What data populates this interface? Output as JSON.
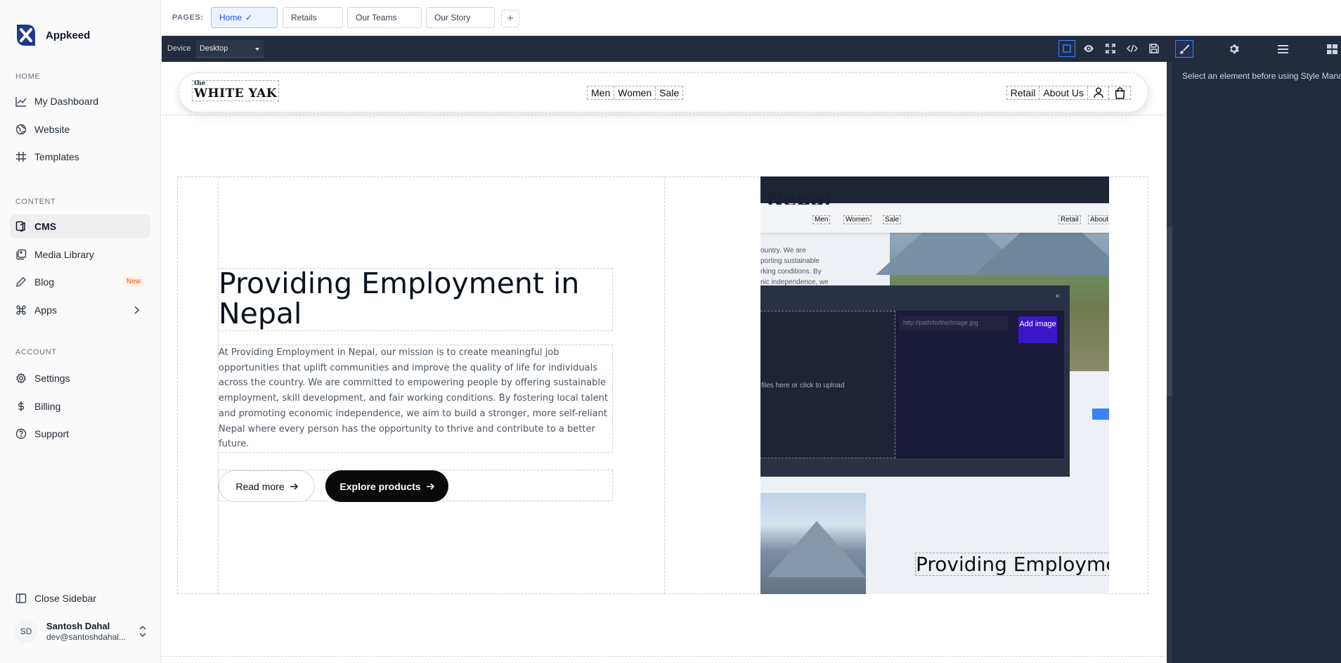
{
  "app": {
    "name": "Appkeed"
  },
  "sidebar": {
    "sections": {
      "home": "HOME",
      "content": "CONTENT",
      "account": "ACCOUNT"
    },
    "items": {
      "dashboard": "My Dashboard",
      "website": "Website",
      "templates": "Templates",
      "cms": "CMS",
      "media": "Media Library",
      "blog": "Blog",
      "blog_badge": "New",
      "apps": "Apps",
      "settings": "Settings",
      "billing": "Billing",
      "support": "Support"
    },
    "close_label": "Close Sidebar",
    "user": {
      "initials": "SD",
      "name": "Santosh Dahal",
      "email": "dev@santoshdahal..."
    }
  },
  "pages_bar": {
    "label": "PAGES:",
    "tabs": [
      "Home",
      "Retails",
      "Our Teams",
      "Our Story"
    ],
    "active_mark": "✓"
  },
  "toolbar": {
    "device_label": "Device",
    "device_value": "Desktop"
  },
  "right_panel": {
    "message": "Select an element before using Style Manager"
  },
  "site": {
    "logo_small": "the",
    "logo_main": "WHITE YAK",
    "menu": [
      "Men",
      "Women",
      "Sale"
    ],
    "right_links": [
      "Retail",
      "About Us"
    ]
  },
  "hero": {
    "title": "Providing Employment in Nepal",
    "body": "At Providing Employment in Nepal, our mission is to create meaningful job opportunities that uplift communities and improve the quality of life for individuals across the country. We are committed to empowering people by offering sustainable employment, skill development, and fair working conditions. By fostering local talent and promoting economic independence, we aim to build a stronger, more self-reliant Nepal where every person has the opportunity to thrive and contribute to a better future.",
    "btn_read": "Read more",
    "btn_explore": "Explore products"
  },
  "preview": {
    "heading": "t Nepal",
    "nav": [
      "Men",
      "Women",
      "Sale",
      "Retail",
      "About"
    ],
    "text_lines": [
      "ountry. We are",
      "porting sustainable",
      "rking conditions. By",
      "nic independence, we"
    ],
    "drop_text": "files here or click to upload",
    "url_placeholder": "http://path/to/the/image.jpg",
    "add_button": "Add image",
    "close": "×",
    "title2": "Providing Employment in Nep"
  },
  "colors": {
    "toolbar": "#232c3f",
    "accent": "#3b82f6",
    "add_button": "#3b16c8"
  }
}
